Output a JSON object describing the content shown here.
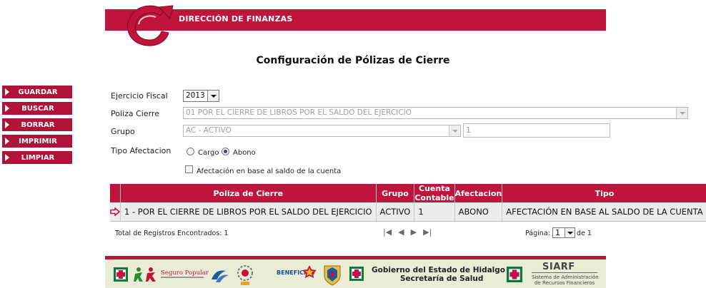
{
  "header": {
    "title": "DIRECCIÓN DE FINANZAS"
  },
  "page": {
    "title": "Configuración de Pólizas de Cierre"
  },
  "sidebar": {
    "items": [
      {
        "label": "GUARDAR"
      },
      {
        "label": "BUSCAR"
      },
      {
        "label": "BORRAR"
      },
      {
        "label": "IMPRIMIR"
      },
      {
        "label": "LIMPIAR"
      }
    ]
  },
  "form": {
    "ejercicio_label": "Ejercicio Fiscal",
    "ejercicio_value": "2013",
    "poliza_label": "Poliza Cierre",
    "poliza_value": "01 POR EL CIERRE DE LIBROS POR EL SALDO DEL EJERCICIO",
    "grupo_label": "Grupo",
    "grupo_value": "AC - ACTIVO",
    "grupo_code": "1",
    "tipo_label": "Tipo Afectacion",
    "tipo_options": [
      "Cargo",
      "Abono"
    ],
    "tipo_selected": "Abono",
    "checkbox_label": "Afectación en base al saldo de la cuenta"
  },
  "table": {
    "columns": [
      "",
      "Poliza de Cierre",
      "Grupo",
      "Cuenta Contable",
      "Afectacion",
      "Tipo"
    ],
    "rows": [
      [
        "1 - POR EL CIERRE DE LIBROS POR EL SALDO DEL EJERCICIO",
        "ACTIVO",
        "1",
        "ABONO",
        "AFECTACIÓN EN BASE AL SALDO DE LA CUENTA"
      ]
    ]
  },
  "pager": {
    "total_text": "Total de Registros Encontrados: 1",
    "page_label": "Página:",
    "page_value": "1",
    "page_of": "de 1"
  },
  "footer": {
    "seguro_popular": "Seguro Popular",
    "beneficios": "BENEFICIOS",
    "gobierno_line1": "Gobierno del Estado de Hidalgo",
    "gobierno_line2": "Secretaría de Salud",
    "siarf": "SIARF",
    "siarf_sub1": "Sistema de Administración",
    "siarf_sub2": "de Recursos Financieros"
  },
  "colors": {
    "brand": "#c0143c",
    "sidebar": "#b01238",
    "footer_bg": "#ebecd5"
  }
}
